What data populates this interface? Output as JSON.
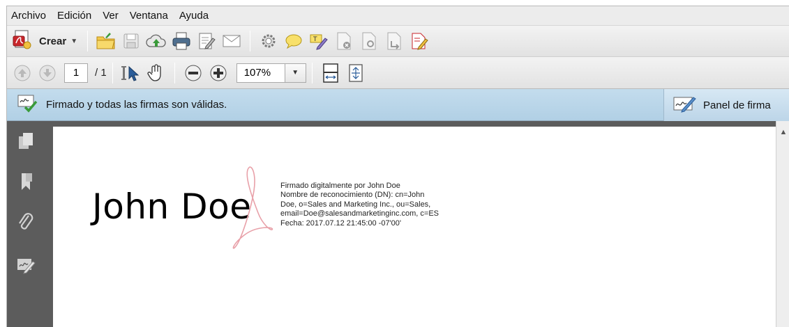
{
  "menu": [
    "Archivo",
    "Edición",
    "Ver",
    "Ventana",
    "Ayuda"
  ],
  "toolbar": {
    "create_label": "Crear",
    "create_caret": "▼",
    "icons": [
      "create-pdf-icon",
      "open-folder-icon",
      "save-icon",
      "cloud-upload-icon",
      "print-icon",
      "edit-document-icon",
      "email-icon",
      "gear-icon",
      "comment-icon",
      "highlight-icon",
      "document-remove-icon",
      "document-sign-icon",
      "document-export-icon",
      "document-edit-icon"
    ]
  },
  "nav": {
    "page_current": "1",
    "page_total": "/ 1",
    "zoom": "107%",
    "zoom_caret": "▼"
  },
  "signature_bar": {
    "status_text": "Firmado y todas las firmas son válidas.",
    "panel_label": "Panel de firma"
  },
  "left_nav": [
    "pages-icon",
    "bookmark-icon",
    "attachment-icon",
    "signature-icon"
  ],
  "document": {
    "signer_name": "John Doe",
    "details": [
      "Firmado digitalmente por John Doe",
      "Nombre de reconocimiento (DN): cn=John",
      "Doe, o=Sales and Marketing Inc., ou=Sales,",
      "email=Doe@salesandmarketinginc.com, c=ES",
      "Fecha: 2017.07.12 21:45:00 -07'00'"
    ]
  },
  "colors": {
    "signature_bar": "#b8d5e9",
    "nav_panel": "#5c5c5c",
    "watermark": "#e8a0a8"
  }
}
